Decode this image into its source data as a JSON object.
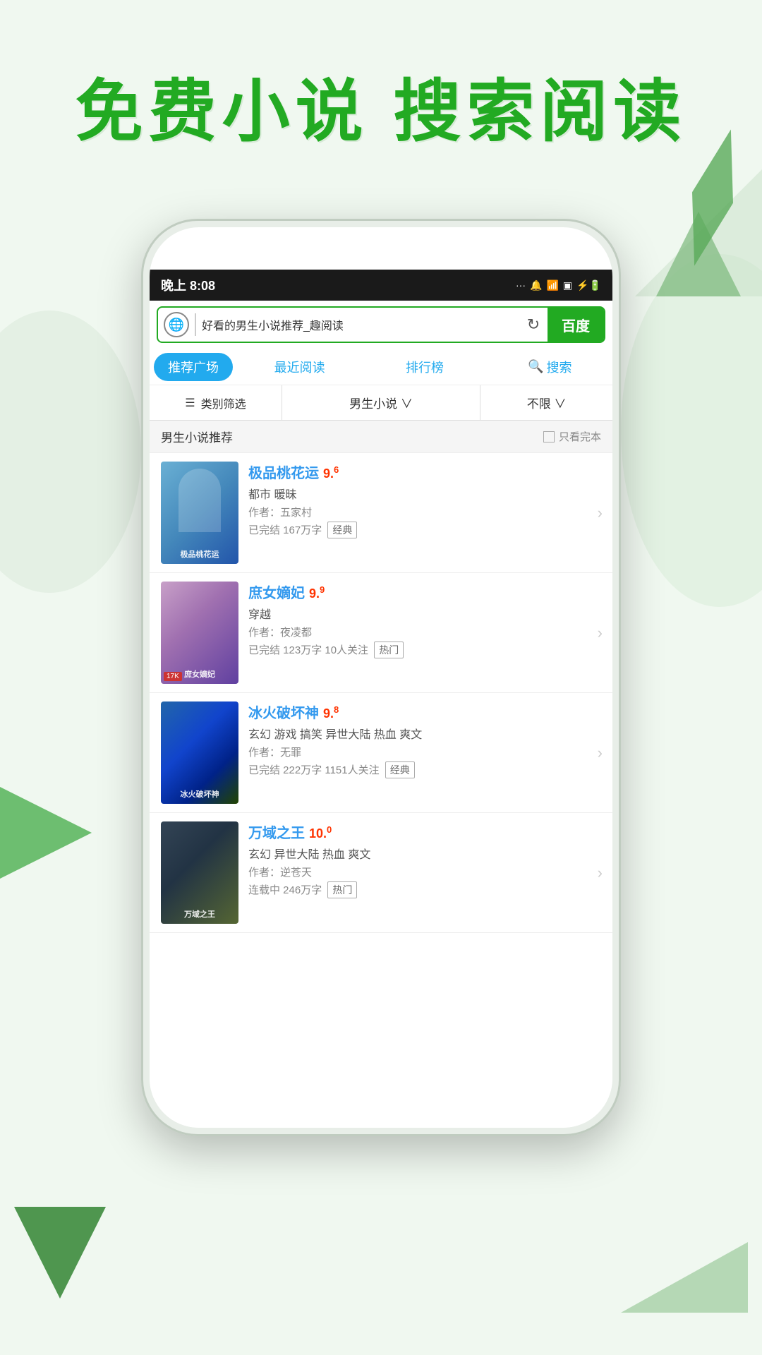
{
  "header": {
    "title": "免费小说  搜索阅读"
  },
  "status_bar": {
    "time": "晚上 8:08",
    "signal": "···",
    "mute": "🔕",
    "wifi": "WiFi",
    "battery": "⚡"
  },
  "browser": {
    "url": "好看的男生小说推荐_趣阅读",
    "baidu_label": "百度"
  },
  "tabs": {
    "items": [
      {
        "label": "推荐广场",
        "active": true
      },
      {
        "label": "最近阅读",
        "active": false
      },
      {
        "label": "排行榜",
        "active": false
      },
      {
        "label": "搜索",
        "active": false,
        "has_icon": true
      }
    ]
  },
  "filters": {
    "category": "类别筛选",
    "gender": "男生小说 ∨",
    "limit": "不限 ∨"
  },
  "section": {
    "title": "男生小说推荐",
    "checkbox_label": "只看完本"
  },
  "books": [
    {
      "title": "极品桃花运",
      "rating": "9",
      "rating_sup": "6",
      "genre": "都市 暖昧",
      "author": "作者：五家村",
      "meta": "已完结 167万字",
      "tag": "经典",
      "cover_class": "cover-1",
      "cover_text": "极品桃花运"
    },
    {
      "title": "庶女嫡妃",
      "rating": "9",
      "rating_sup": "9",
      "genre": "穿越",
      "author": "作者：夜凌都",
      "meta": "已完结 123万字 10人关注",
      "tag": "热门",
      "cover_class": "cover-2",
      "cover_text": "庶女嫡妃",
      "badge": "17K"
    },
    {
      "title": "冰火破坏神",
      "rating": "9",
      "rating_sup": "8",
      "genre": "玄幻 游戏 搞笑 异世大陆 热血 爽文",
      "author": "作者：无罪",
      "meta": "已完结 222万字 1151人关注",
      "tag": "经典",
      "cover_class": "cover-3",
      "cover_text": "冰火破坏神"
    },
    {
      "title": "万域之王",
      "rating": "10",
      "rating_sup": "0",
      "genre": "玄幻 异世大陆 热血 爽文",
      "author": "作者：逆苍天",
      "meta": "连载中 246万字",
      "tag": "热门",
      "cover_class": "cover-4",
      "cover_text": "万域之王"
    }
  ]
}
